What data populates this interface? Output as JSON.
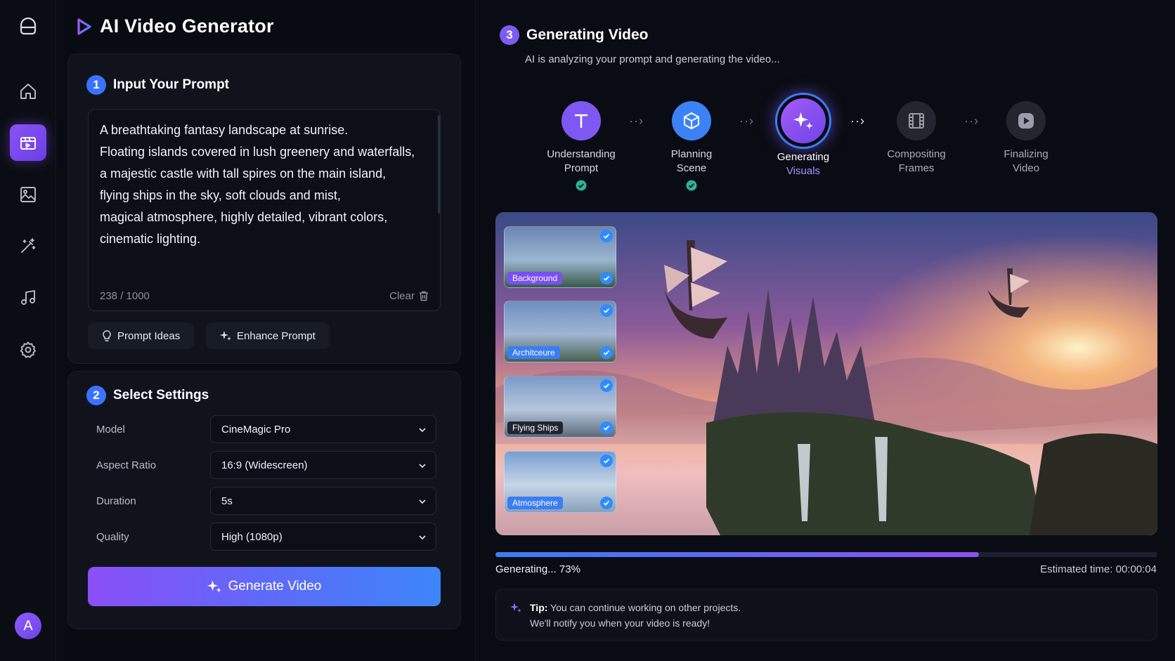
{
  "app": {
    "title": "AI Video Generator"
  },
  "sidebar": {
    "items": [
      {
        "name": "home-icon"
      },
      {
        "name": "video-icon",
        "active": true
      },
      {
        "name": "image-icon"
      },
      {
        "name": "magic-wand-icon"
      },
      {
        "name": "music-icon"
      },
      {
        "name": "gear-icon"
      }
    ],
    "avatar_letter": "A"
  },
  "prompt_section": {
    "step_number": "1",
    "title": "Input Your Prompt",
    "prompt_text": "A breathtaking fantasy landscape at sunrise.\nFloating islands covered in lush greenery and waterfalls,\na majestic castle with tall spires on the main island,\nflying ships in the sky, soft clouds and mist,\nmagical atmosphere, highly detailed, vibrant colors,\ncinematic lighting.",
    "char_count": "238 / 1000",
    "clear_label": "Clear",
    "prompt_ideas_label": "Prompt Ideas",
    "enhance_label": "Enhance Prompt"
  },
  "settings_section": {
    "step_number": "2",
    "title": "Select Settings",
    "rows": [
      {
        "label": "Model",
        "value": "CineMagic Pro"
      },
      {
        "label": "Aspect Ratio",
        "value": "16:9 (Widescreen)"
      },
      {
        "label": "Duration",
        "value": "5s"
      },
      {
        "label": "Quality",
        "value": "High (1080p)"
      }
    ],
    "generate_label": "Generate Video"
  },
  "generation": {
    "step_number": "3",
    "title": "Generating Video",
    "subtitle": "AI is analyzing your prompt and generating the video...",
    "stages": [
      {
        "line1": "Understanding",
        "line2": "Prompt",
        "state": "done"
      },
      {
        "line1": "Planning",
        "line2": "Scene",
        "state": "done"
      },
      {
        "line1": "Generating",
        "line2": "Visuals",
        "state": "active"
      },
      {
        "line1": "Compositing",
        "line2": "Frames",
        "state": "pending"
      },
      {
        "line1": "Finalizing",
        "line2": "Video",
        "state": "pending"
      }
    ],
    "thumbnails": [
      {
        "label": "Background"
      },
      {
        "label": "Architceure"
      },
      {
        "label": "Flying Ships"
      },
      {
        "label": "Atmosphere"
      }
    ],
    "progress_percent": 73,
    "progress_label": "Generating... 73%",
    "eta_label": "Estimated time: 00:00:04",
    "tip_bold": "Tip:",
    "tip_line1": " You can continue working on other projects.",
    "tip_line2": "We'll notify you when your video is ready!"
  },
  "colors": {
    "accent_purple": "#8a4ff6",
    "accent_blue": "#3d86f8",
    "check_green": "#2bb39a"
  }
}
